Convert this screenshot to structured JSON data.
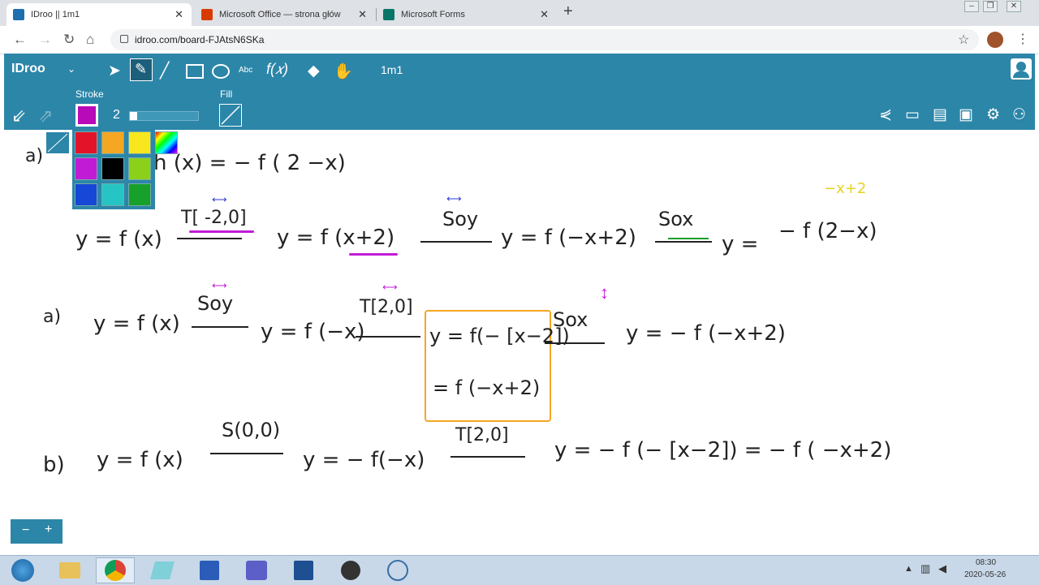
{
  "browser": {
    "tabs": [
      {
        "title": "IDroo || 1m1",
        "active": true,
        "favicon_color": "#1d6fae"
      },
      {
        "title": "Microsoft Office — strona główna",
        "active": false,
        "favicon_color": "#d83b01"
      },
      {
        "title": "Microsoft Forms",
        "active": false,
        "favicon_color": "#077568"
      }
    ],
    "new_tab": "+",
    "close": "✕",
    "url": "idroo.com/board-FJAtsN6SKa"
  },
  "app": {
    "logo": "IDroo",
    "board_name": "1m1",
    "stroke_label": "Stroke",
    "stroke_size": "2",
    "stroke_color": "#b80ab8",
    "fill_label": "Fill",
    "zoom_minus": "−",
    "zoom_plus": "+",
    "palette_colors": [
      "none",
      "#e3142a",
      "#f5a623",
      "#f8e71c",
      "rainbow",
      "#c21bd6",
      "#000000",
      "#8bd11a",
      "#1747d6",
      "#26c4c4",
      "#17a02b"
    ]
  },
  "board": {
    "top_fragment": "h (x) = − f ( 2 −x)",
    "top_fragment_prefix": "a)",
    "row1": {
      "eq1": "y = f (x)",
      "t1": "T[ -2,0]",
      "eq2": "y = f (x+2)",
      "s1": "Soy",
      "eq3": "y = f (−x+2)",
      "s2": "Sox",
      "eq4": "y =",
      "eq4b": "− f (2−x)",
      "note": "−x+2"
    },
    "row2": {
      "label": "a)",
      "eq1": "y = f (x)",
      "s1": "Soy",
      "eq2": "y = f (−x)",
      "t1": "T[2,0]",
      "box1": "y = f(− [x−2])",
      "box2": "= f (−x+2)",
      "s2": "Sox",
      "eq3": "y = − f (−x+2)"
    },
    "row3": {
      "label": "b)",
      "eq1": "y = f (x)",
      "s1": "S(0,0)",
      "eq2": "y = − f(−x)",
      "t1": "T[2,0]",
      "eq3": "y = − f (− [x−2]) = − f ( −x+2)"
    }
  },
  "taskbar": {
    "time": "08:30",
    "date": "2020-05-26"
  }
}
